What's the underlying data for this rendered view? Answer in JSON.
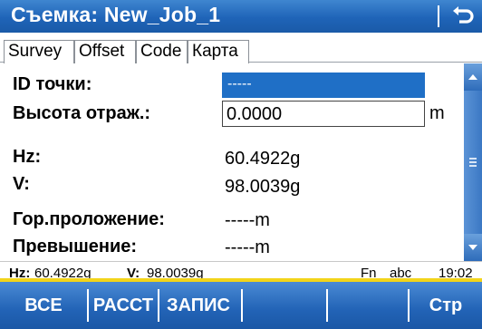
{
  "window": {
    "title": "Съемка: New_Job_1"
  },
  "tabs": [
    {
      "label": "Survey"
    },
    {
      "label": "Offset"
    },
    {
      "label": "Code"
    },
    {
      "label": "Карта"
    }
  ],
  "form": {
    "point_id": {
      "label": "ID точки:",
      "value": "-----"
    },
    "reflector_height": {
      "label": "Высота отраж.:",
      "value": "0.0000",
      "unit": "m"
    },
    "hz": {
      "label": "Hz:",
      "value": "60.4922g"
    },
    "v": {
      "label": "V:",
      "value": "98.0039g"
    },
    "horizontal_distance": {
      "label": "Гор.проложение:",
      "value": "-----m"
    },
    "height_difference": {
      "label": "Превышение:",
      "value": "-----m"
    }
  },
  "statusbar": {
    "hz_label": "Hz:",
    "hz_value": "60.4922g",
    "v_label": "V:",
    "v_value": "98.0039g",
    "fn": "Fn",
    "input_mode": "abc",
    "time": "19:02"
  },
  "softkeys": [
    {
      "label": "ВСЕ"
    },
    {
      "label": "РАССТ"
    },
    {
      "label": "ЗАПИС"
    },
    {
      "label": ""
    },
    {
      "label": ""
    },
    {
      "label": "Стр"
    }
  ],
  "colors": {
    "titlebar": "#1f64b8",
    "selection": "#1f6fc6",
    "accent_line": "#f2d41a"
  },
  "icons": {
    "back": "return-arrow-icon",
    "scroll_up": "triangle-up-icon",
    "scroll_down": "triangle-down-icon"
  }
}
